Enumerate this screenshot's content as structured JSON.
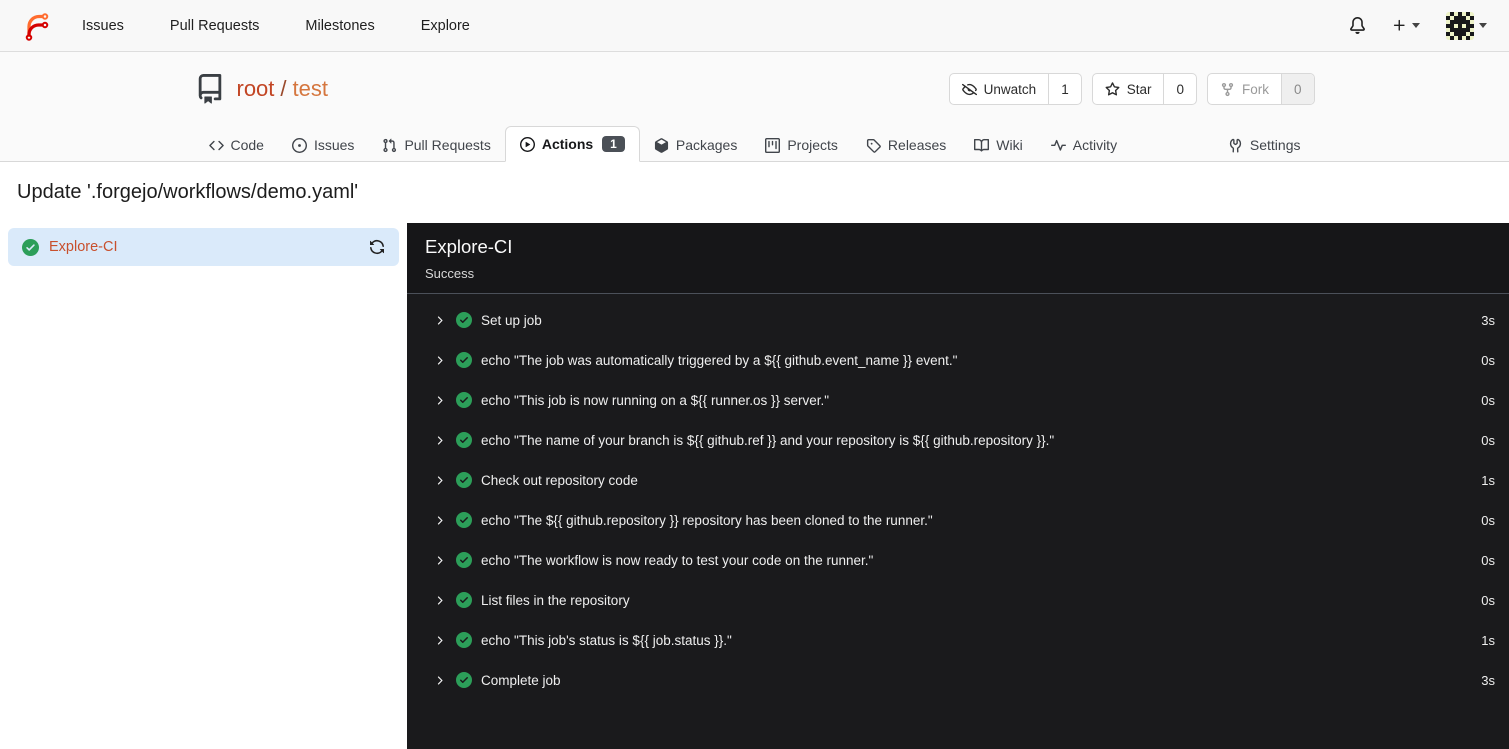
{
  "navbar": {
    "items": [
      {
        "label": "Issues"
      },
      {
        "label": "Pull Requests"
      },
      {
        "label": "Milestones"
      },
      {
        "label": "Explore"
      }
    ],
    "icons": {
      "bell": "notifications",
      "plus": "create-new",
      "avatar": "user-identicon"
    }
  },
  "repo": {
    "owner": "root",
    "separator": "/",
    "name": "test",
    "actions": {
      "watch": {
        "label": "Unwatch",
        "count": "1"
      },
      "star": {
        "label": "Star",
        "count": "0"
      },
      "fork": {
        "label": "Fork",
        "count": "0"
      }
    }
  },
  "tabs": [
    {
      "label": "Code"
    },
    {
      "label": "Issues"
    },
    {
      "label": "Pull Requests"
    },
    {
      "label": "Actions",
      "badge": "1",
      "active": true
    },
    {
      "label": "Packages"
    },
    {
      "label": "Projects"
    },
    {
      "label": "Releases"
    },
    {
      "label": "Wiki"
    },
    {
      "label": "Activity"
    },
    {
      "label": "Settings"
    }
  ],
  "page": {
    "title": "Update '.forgejo/workflows/demo.yaml'"
  },
  "sidebar": {
    "jobs": [
      {
        "name": "Explore-CI",
        "status": "success",
        "selected": true
      }
    ]
  },
  "run_panel": {
    "title": "Explore-CI",
    "status": "Success",
    "steps": [
      {
        "name": "Set up job",
        "duration": "3s"
      },
      {
        "name": "echo \"The job was automatically triggered by a ${{ github.event_name }} event.\"",
        "duration": "0s"
      },
      {
        "name": "echo \"This job is now running on a ${{ runner.os }} server.\"",
        "duration": "0s"
      },
      {
        "name": "echo \"The name of your branch is ${{ github.ref }} and your repository is ${{ github.repository }}.\"",
        "duration": "0s"
      },
      {
        "name": "Check out repository code",
        "duration": "1s"
      },
      {
        "name": "echo \"The ${{ github.repository }} repository has been cloned to the runner.\"",
        "duration": "0s"
      },
      {
        "name": "echo \"The workflow is now ready to test your code on the runner.\"",
        "duration": "0s"
      },
      {
        "name": "List files in the repository",
        "duration": "0s"
      },
      {
        "name": "echo \"This job's status is ${{ job.status }}.\"",
        "duration": "1s"
      },
      {
        "name": "Complete job",
        "duration": "3s"
      }
    ]
  },
  "colors": {
    "accent_orange": "#d5763e",
    "accent_red": "#c24524",
    "success_green": "#2c9e59",
    "selected_job_bg": "#daeafa",
    "panel_dark": "#1a1a1c",
    "badge_bg": "#4b5057"
  }
}
